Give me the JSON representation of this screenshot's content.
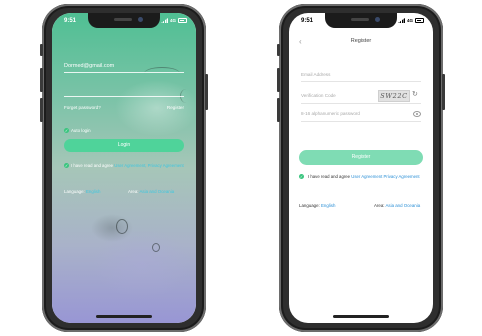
{
  "status_bar": {
    "time": "9:51",
    "network": "4G"
  },
  "login": {
    "email_value": "Dormed@gmail.com",
    "forgot_label": "Forget password?",
    "register_label": "Register",
    "auto_login_label": "Auto login",
    "login_button": "Login",
    "agree_text": "I have read and agree",
    "agree_links": "User Agreement, Privacy Agreement",
    "language_label": "Language:",
    "language_value": "English",
    "area_label": "Area:",
    "area_value": "Asia and Oceania"
  },
  "register": {
    "back_icon": "chevron-left-icon",
    "title": "Register",
    "email_placeholder": "Email Address",
    "code_placeholder": "Verification Code",
    "captcha_text": "SW22C",
    "password_placeholder": "8-16 alphanumeric password",
    "register_button": "Register",
    "agree_text": "I have read and agree",
    "agreement_link": "User Agreement",
    "privacy_link": "Privacy Agreement",
    "language_label": "Language:",
    "language_value": "English",
    "area_label": "Area:",
    "area_value": "Asia and Oceania"
  },
  "colors": {
    "accent": "#4fd39a",
    "link": "#2a8fd6",
    "check": "#39c57e"
  }
}
